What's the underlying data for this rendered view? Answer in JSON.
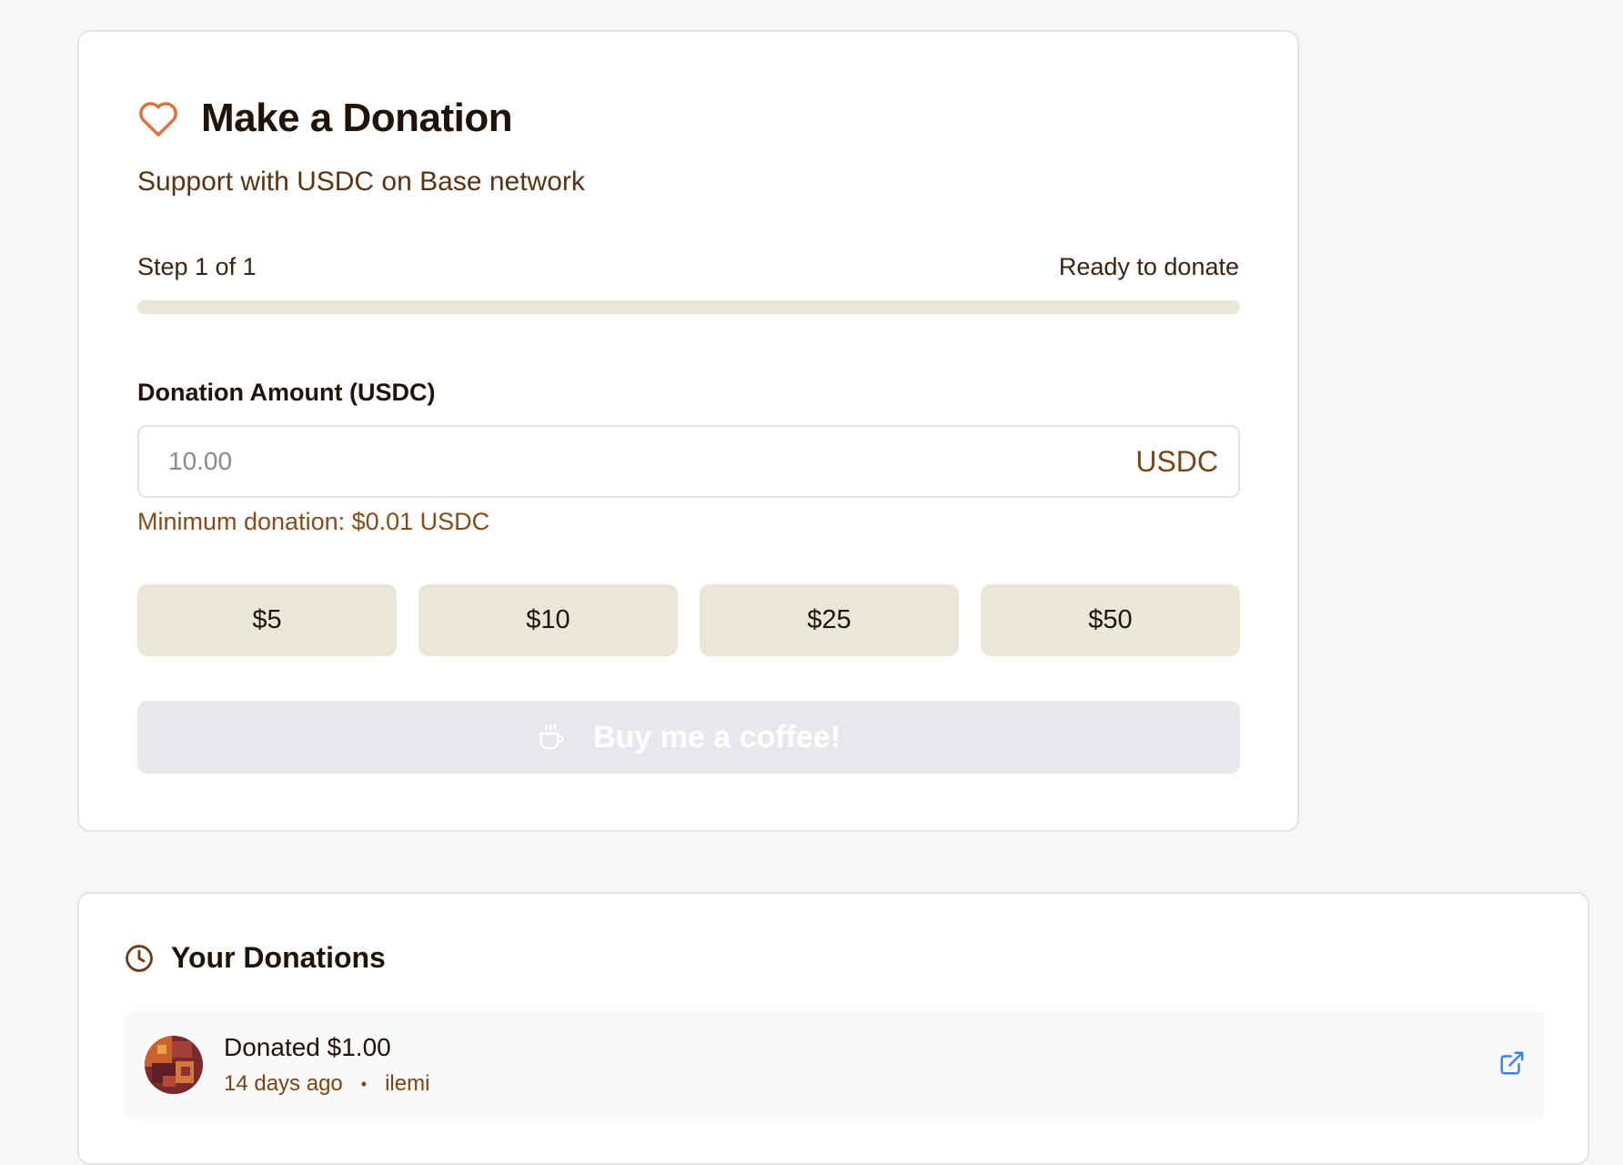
{
  "donate": {
    "title": "Make a Donation",
    "subtitle": "Support with USDC on Base network",
    "step_label": "Step 1 of 1",
    "step_status": "Ready to donate",
    "progress": 1.0,
    "amount_label": "Donation Amount (USDC)",
    "amount_placeholder": "10.00",
    "amount_value": "",
    "currency_suffix": "USDC",
    "min_note": "Minimum donation: $0.01 USDC",
    "presets": [
      "$5",
      "$10",
      "$25",
      "$50"
    ],
    "submit_label": "Buy me a coffee!",
    "submit_enabled": false,
    "icons": {
      "title": "heart-icon",
      "submit": "coffee-cup-icon"
    }
  },
  "history": {
    "title": "Your Donations",
    "icon": "clock-icon",
    "items": [
      {
        "amount_text": "Donated $1.00",
        "time_ago": "14 days ago",
        "separator": "•",
        "user": "ilemi",
        "link_icon": "external-link-icon"
      }
    ]
  },
  "colors": {
    "page_bg": "#f7f7f7",
    "accent_heart": "#e0703c",
    "beige": "#ebe7d8",
    "brown_text": "#7a4516",
    "link_blue": "#3b82f6",
    "disabled_btn": "#e7e8ec"
  }
}
